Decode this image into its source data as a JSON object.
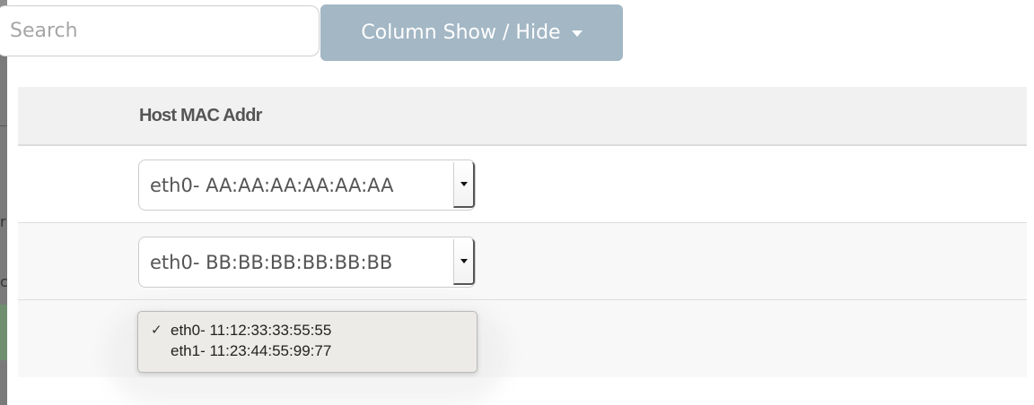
{
  "search": {
    "placeholder": "Search",
    "value": ""
  },
  "column_toggle": {
    "label": "Column Show / Hide"
  },
  "table": {
    "columns": [
      "Host MAC Addr"
    ],
    "rows": [
      {
        "mac_select": "eth0- AA:AA:AA:AA:AA:AA"
      },
      {
        "mac_select": "eth0- BB:BB:BB:BB:BB:BB"
      }
    ]
  },
  "dropdown": {
    "options": [
      {
        "label": "eth0- 11:12:33:33:55:55",
        "checked": true
      },
      {
        "label": "eth1- 11:23:44:55:99:77",
        "checked": false
      }
    ],
    "check_symbol": "✓"
  },
  "edge_glyphs": [
    "r",
    "c"
  ],
  "colors": {
    "button_bg": "#a3b7c5",
    "header_bg": "#f1f1f1",
    "row_alt_bg": "#f8f8f8",
    "popup_bg": "#ecebe7"
  }
}
